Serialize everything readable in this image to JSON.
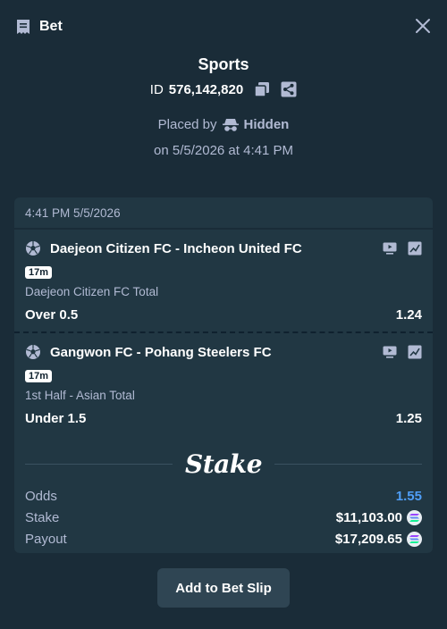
{
  "header": {
    "title": "Bet"
  },
  "summary": {
    "sport": "Sports",
    "id_prefix": "ID",
    "id_value": "576,142,820",
    "placed_by_label": "Placed by",
    "placed_by_user": "Hidden",
    "placed_on": "on 5/5/2026 at 4:41 PM"
  },
  "card": {
    "time": "4:41 PM 5/5/2026",
    "legs": [
      {
        "match": "Daejeon Citizen FC - Incheon United FC",
        "badge": "17m",
        "market": "Daejeon Citizen FC Total",
        "selection": "Over 0.5",
        "odds": "1.24"
      },
      {
        "match": "Gangwon FC - Pohang Steelers FC",
        "badge": "17m",
        "market": "1st Half - Asian Total",
        "selection": "Under 1.5",
        "odds": "1.25"
      }
    ],
    "brand": "Stake",
    "totals": {
      "odds_label": "Odds",
      "odds_value": "1.55",
      "stake_label": "Stake",
      "stake_value": "$11,103.00",
      "payout_label": "Payout",
      "payout_value": "$17,209.65"
    }
  },
  "actions": {
    "add_label": "Add to Bet Slip"
  },
  "colors": {
    "background": "#1a2c38",
    "card": "#213743",
    "accent_blue": "#4f9ef7",
    "muted": "#b1bad3",
    "button": "#2f4553"
  }
}
